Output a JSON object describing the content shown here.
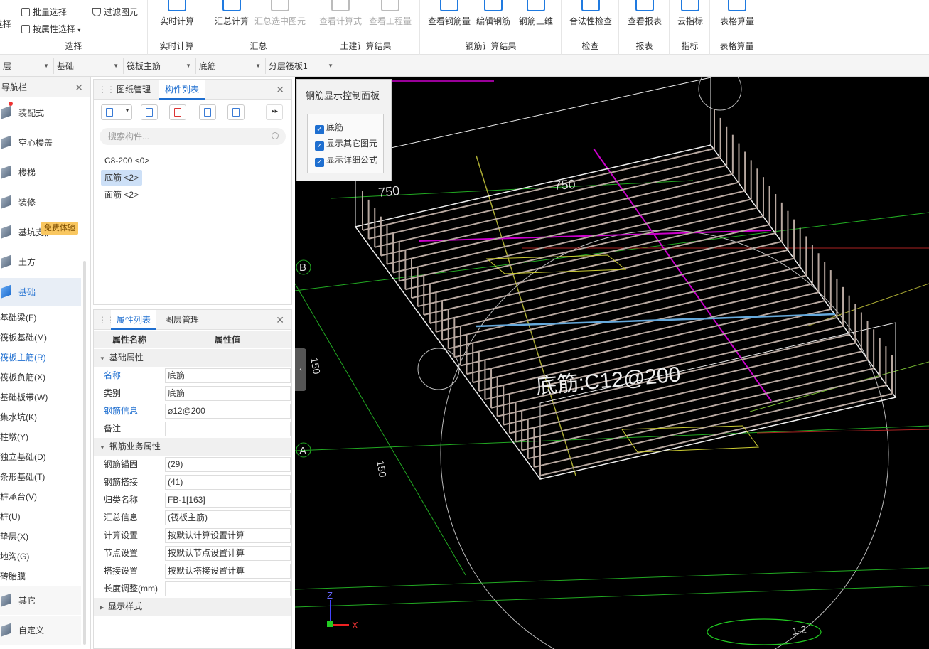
{
  "ribbon": {
    "groups": [
      {
        "label": "选择"
      },
      {
        "label": "实时计算"
      },
      {
        "label": "汇总"
      },
      {
        "label": "土建计算结果"
      },
      {
        "label": "钢筋计算结果"
      },
      {
        "label": "检查"
      },
      {
        "label": "报表"
      },
      {
        "label": "指标"
      },
      {
        "label": "表格算量"
      }
    ],
    "select_btn": "选择",
    "batch_select": "批量选择",
    "filter_elements": "过滤图元",
    "select_by_attr": "按属性选择",
    "realtime_calc": "实时计算",
    "summary_calc": "汇总计算",
    "summary_selected": "汇总选中图元",
    "view_formula": "查看计算式",
    "view_quantity": "查看工程量",
    "view_rebar_qty": "查看钢筋量",
    "edit_rebar": "编辑钢筋",
    "rebar_3d": "钢筋三维",
    "legality_check": "合法性检查",
    "view_report": "查看报表",
    "cloud_index": "云指标",
    "table_calc": "表格算量"
  },
  "selectors": [
    "层",
    "基础",
    "筏板主筋",
    "底筋",
    "分层筏板1"
  ],
  "nav": {
    "title": "导航栏",
    "items": [
      {
        "label": "装配式"
      },
      {
        "label": "空心楼盖"
      },
      {
        "label": "楼梯"
      },
      {
        "label": "装修"
      },
      {
        "label": "基坑支护"
      },
      {
        "label": "土方"
      },
      {
        "label": "基础"
      }
    ],
    "badge": "免费体验",
    "sub_items": [
      {
        "label": "基础梁(F)"
      },
      {
        "label": "筏板基础(M)"
      },
      {
        "label": "筏板主筋(R)"
      },
      {
        "label": "筏板负筋(X)"
      },
      {
        "label": "基础板带(W)"
      },
      {
        "label": "集水坑(K)"
      },
      {
        "label": "柱墩(Y)"
      },
      {
        "label": "独立基础(D)"
      },
      {
        "label": "条形基础(T)"
      },
      {
        "label": "桩承台(V)"
      },
      {
        "label": "桩(U)"
      },
      {
        "label": "垫层(X)"
      },
      {
        "label": "地沟(G)"
      },
      {
        "label": "砖胎膜"
      }
    ],
    "bottom_items": [
      {
        "label": "其它"
      },
      {
        "label": "自定义"
      }
    ]
  },
  "component_panel": {
    "tab_drawings": "图纸管理",
    "tab_components": "构件列表",
    "search_placeholder": "搜索构件...",
    "items": [
      {
        "label": "C8-200 <0>"
      },
      {
        "label": "底筋 <2>"
      },
      {
        "label": "面筋 <2>"
      }
    ]
  },
  "props_panel": {
    "tab_props": "属性列表",
    "tab_layers": "图层管理",
    "col_name": "属性名称",
    "col_value": "属性值",
    "group_basic": "基础属性",
    "group_rebar": "钢筋业务属性",
    "group_display": "显示样式",
    "rows_basic": [
      {
        "name": "名称",
        "value": "底筋"
      },
      {
        "name": "类别",
        "value": "底筋"
      },
      {
        "name": "钢筋信息",
        "value": "⌀12@200"
      },
      {
        "name": "备注",
        "value": ""
      }
    ],
    "rows_rebar": [
      {
        "name": "钢筋锚固",
        "value": "(29)"
      },
      {
        "name": "钢筋搭接",
        "value": "(41)"
      },
      {
        "name": "归类名称",
        "value": "FB-1[163]"
      },
      {
        "name": "汇总信息",
        "value": "(筏板主筋)"
      },
      {
        "name": "计算设置",
        "value": "按默认计算设置计算"
      },
      {
        "name": "节点设置",
        "value": "按默认节点设置计算"
      },
      {
        "name": "搭接设置",
        "value": "按默认搭接设置计算"
      },
      {
        "name": "长度调整(mm)",
        "value": ""
      }
    ]
  },
  "control_panel": {
    "title": "钢筋显示控制面板",
    "options": [
      {
        "label": "底筋"
      },
      {
        "label": "显示其它图元"
      },
      {
        "label": "显示详细公式"
      }
    ]
  },
  "viewport": {
    "dim_left": "750",
    "dim_right": "750",
    "axis_b": "B",
    "axis_a": "A",
    "rebar_label": "底筋:C12@200",
    "section_label": "1-2",
    "dim_side1": "150",
    "dim_side2": "150",
    "axis_x": "X",
    "axis_z": "Z"
  }
}
